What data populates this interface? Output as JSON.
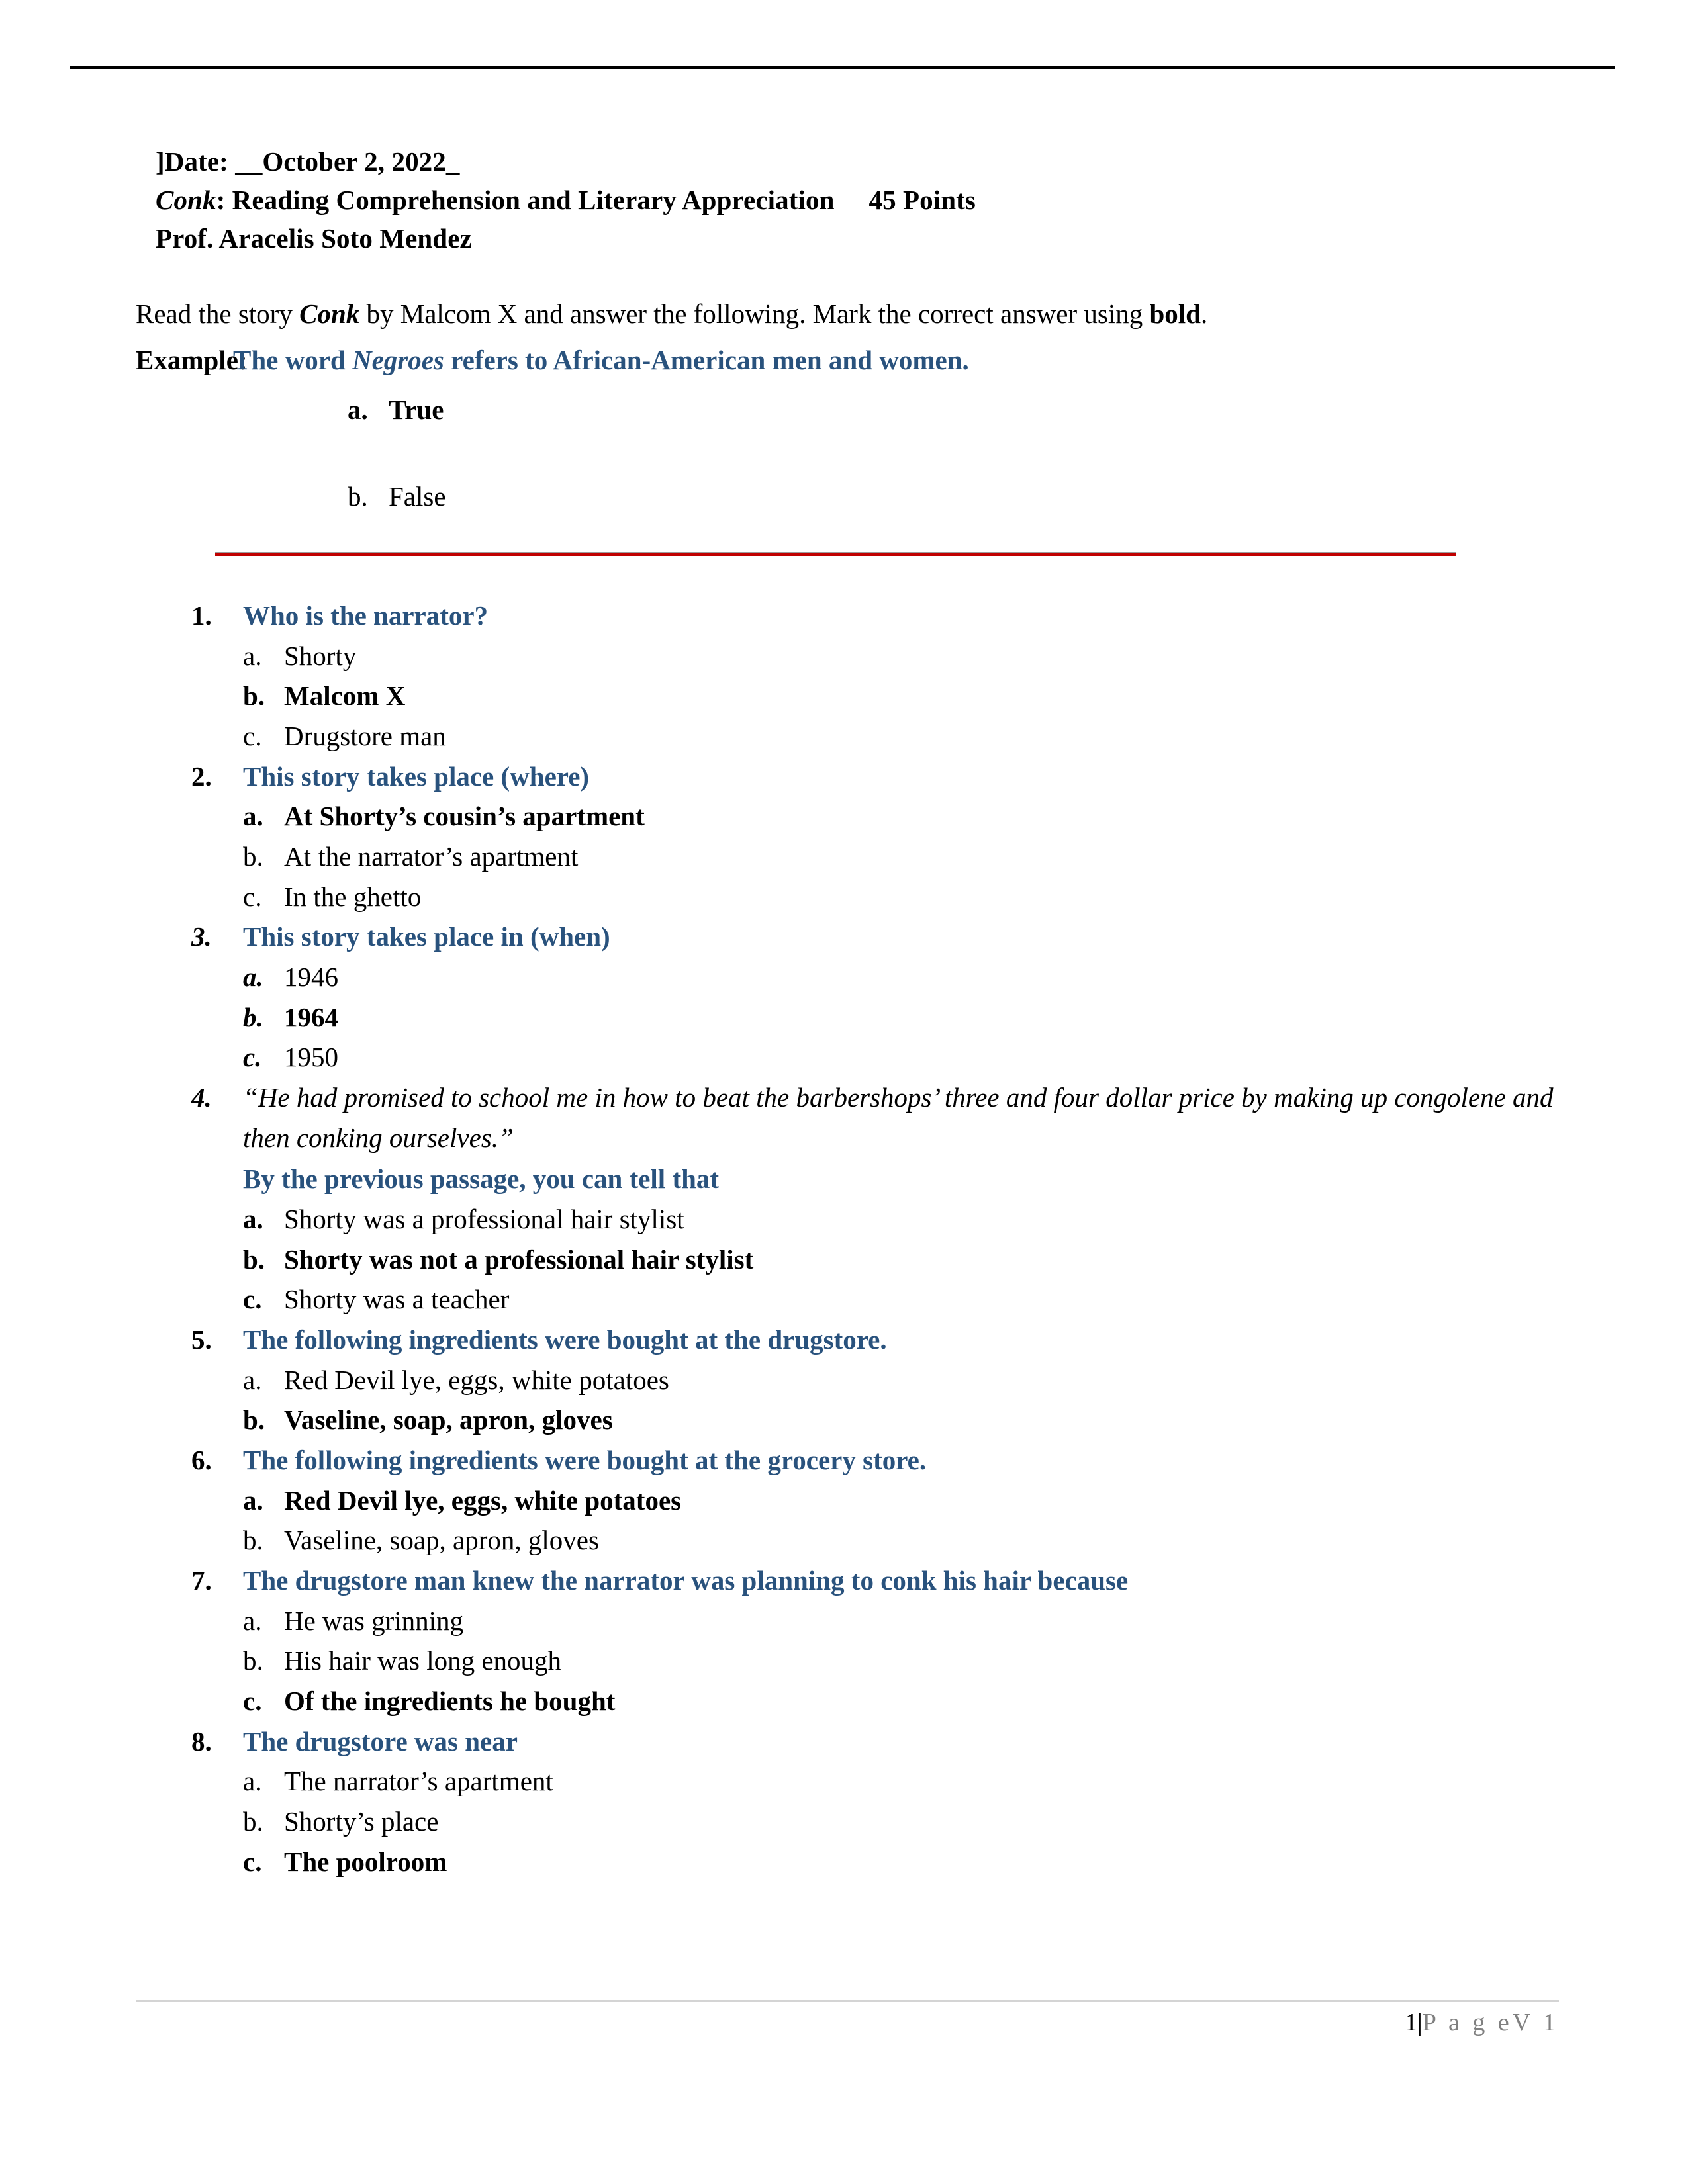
{
  "header": {
    "date_line": "]Date:  __October 2, 2022_",
    "title_course_italic": "Conk",
    "title_rest": ":  Reading Comprehension and Literary Appreciation",
    "points": "45 Points",
    "professor": "Prof. Aracelis Soto Mendez"
  },
  "instructions": {
    "prefix": "Read the story ",
    "story_title": "Conk",
    "middle": " by Malcom X and answer the following.  Mark the correct answer using ",
    "bold_word": "bold",
    "suffix": ".",
    "example_label": "Example:",
    "example_prefix": "The word ",
    "example_italic": "Negroes",
    "example_suffix": " refers to African-American men and women.",
    "example_options": [
      {
        "marker": "a.",
        "text": "True",
        "bold": true
      },
      {
        "marker": "b.",
        "text": "False",
        "bold": false
      }
    ]
  },
  "questions": [
    {
      "number": "1.",
      "number_italic": false,
      "stem": "Who is the narrator?",
      "options": [
        {
          "marker": "a.",
          "text": "Shorty",
          "bold": false,
          "italic_marker": false
        },
        {
          "marker": "b.",
          "text": "Malcom X",
          "bold": true,
          "italic_marker": false
        },
        {
          "marker": "c.",
          "text": "Drugstore man",
          "bold": false,
          "italic_marker": false
        }
      ]
    },
    {
      "number": "2.",
      "number_italic": false,
      "stem": "This story takes place (where)",
      "options": [
        {
          "marker": "a.",
          "text": "At Shorty’s cousin’s apartment",
          "bold": true,
          "italic_marker": false
        },
        {
          "marker": "b.",
          "text": "At the narrator’s apartment",
          "bold": false,
          "italic_marker": false
        },
        {
          "marker": "c.",
          "text": "In the ghetto",
          "bold": false,
          "italic_marker": false
        }
      ]
    },
    {
      "number": "3.",
      "number_italic": true,
      "stem": "This story takes place in (when)",
      "options": [
        {
          "marker": "a.",
          "text": "1946",
          "bold": false,
          "italic_marker": true
        },
        {
          "marker": "b.",
          "text": "1964",
          "bold": true,
          "italic_marker": true
        },
        {
          "marker": "c.",
          "text": "1950",
          "bold": false,
          "italic_marker": true
        }
      ]
    },
    {
      "number": "4.",
      "number_italic": true,
      "quote": "“He had promised to school me in how to beat the barbershops’ three and four dollar price by making up congolene and then conking ourselves.”",
      "quote_open_bold": "“",
      "quote_close_bold": ".”",
      "sub_stem": "By the previous passage, you can tell that",
      "options": [
        {
          "marker": "a.",
          "text": "Shorty was a professional hair stylist",
          "bold": false,
          "italic_marker": false
        },
        {
          "marker": "b.",
          "text": "Shorty was not a professional hair stylist",
          "bold": true,
          "italic_marker": false
        },
        {
          "marker": "c.",
          "text": "Shorty was a teacher",
          "bold": false,
          "italic_marker": false
        }
      ]
    },
    {
      "number": "5.",
      "number_italic": false,
      "stem": "The following ingredients were bought at the drugstore.",
      "options": [
        {
          "marker": "a.",
          "text": "Red Devil lye, eggs, white potatoes",
          "bold": false,
          "italic_marker": false
        },
        {
          "marker": "b.",
          "text": "Vaseline, soap, apron, gloves",
          "bold": true,
          "italic_marker": false
        }
      ]
    },
    {
      "number": "6.",
      "number_italic": false,
      "stem": "The following ingredients were bought at the grocery store.",
      "options": [
        {
          "marker": "a.",
          "text": "Red Devil lye, eggs, white potatoes",
          "bold": true,
          "italic_marker": false
        },
        {
          "marker": "b.",
          "text": "Vaseline, soap, apron, gloves",
          "bold": false,
          "italic_marker": false
        }
      ]
    },
    {
      "number": "7.",
      "number_italic": false,
      "stem": "The drugstore man knew the narrator was planning to conk his hair because",
      "options": [
        {
          "marker": "a.",
          "text": "He was grinning",
          "bold": false,
          "italic_marker": false
        },
        {
          "marker": "b.",
          "text": "His hair was long enough",
          "bold": false,
          "italic_marker": false
        },
        {
          "marker": "c.",
          "text": "Of the ingredients he bought",
          "bold": true,
          "italic_marker": false
        }
      ]
    },
    {
      "number": "8.",
      "number_italic": false,
      "stem": "The drugstore was near",
      "options": [
        {
          "marker": "a.",
          "text": "The narrator’s apartment",
          "bold": false,
          "italic_marker": false
        },
        {
          "marker": "b.",
          "text": "Shorty’s place",
          "bold": false,
          "italic_marker": false
        },
        {
          "marker": "c.",
          "text": "The poolroom",
          "bold": true,
          "italic_marker": false
        }
      ]
    }
  ],
  "footer": {
    "page_number": "1",
    "separator": "|",
    "page_word": "P a g e",
    "version": "V 1"
  },
  "colors": {
    "heading_blue": "#29527D",
    "divider_red": "#C00000",
    "footer_gray": "#808080"
  }
}
